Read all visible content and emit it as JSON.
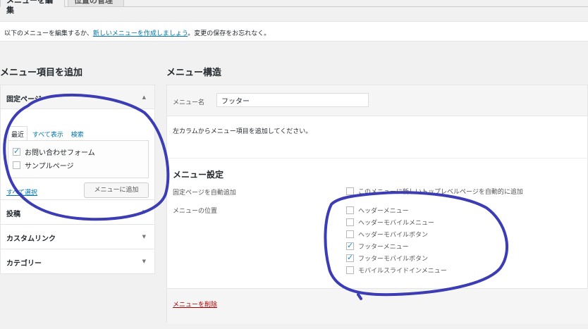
{
  "tabs": {
    "edit_menus": "メニューを編集",
    "manage_locations": "位置の管理"
  },
  "manage_bar": {
    "prefix": "以下のメニューを編集するか、",
    "create_link": "新しいメニューを作成しましょう",
    "suffix": "。変更の保存をお忘れなく。"
  },
  "left": {
    "title": "メニュー項目を追加",
    "sections": [
      {
        "label": "固定ページ",
        "open": true
      },
      {
        "label": "投稿"
      },
      {
        "label": "カスタムリンク"
      },
      {
        "label": "カテゴリー"
      }
    ],
    "sub_tabs": [
      "最近",
      "すべて表示",
      "検索"
    ],
    "items": [
      {
        "label": "お問い合わせフォーム",
        "checked": true
      },
      {
        "label": "サンプルページ",
        "checked": false
      }
    ],
    "select_all": "すべて選択",
    "add_button": "メニューに追加"
  },
  "right": {
    "title": "メニュー構造",
    "name_label": "メニュー名",
    "name_value": "フッター",
    "instruction": "左カラムからメニュー項目を追加してください。",
    "settings_title": "メニュー設定",
    "auto_add_label": "固定ページを自動追加",
    "auto_add_option": "このメニューに新しいトップレベルページを自動的に追加",
    "location_label": "メニューの位置",
    "locations": [
      {
        "label": "ヘッダーメニュー",
        "checked": false
      },
      {
        "label": "ヘッダーモバイルメニュー",
        "checked": false
      },
      {
        "label": "ヘッダーモバイルボタン",
        "checked": false
      },
      {
        "label": "フッターメニュー",
        "checked": true
      },
      {
        "label": "フッターモバイルボタン",
        "checked": true
      },
      {
        "label": "モバイルスライドインメニュー",
        "checked": false
      }
    ],
    "delete_link": "メニューを削除"
  },
  "colors": {
    "link": "#0073aa",
    "delete": "#a00000",
    "annotation": "#3c3cb4"
  }
}
